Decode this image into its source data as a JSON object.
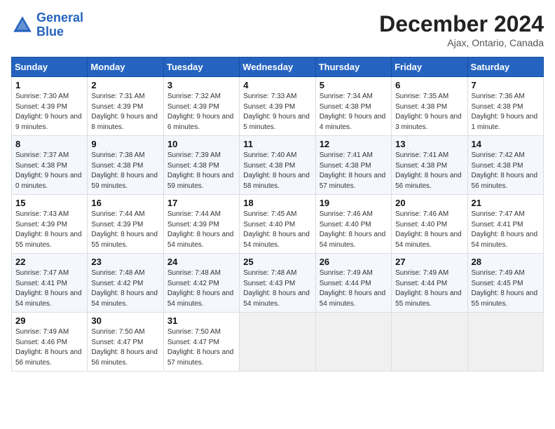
{
  "header": {
    "logo_line1": "General",
    "logo_line2": "Blue",
    "month_title": "December 2024",
    "location": "Ajax, Ontario, Canada"
  },
  "weekdays": [
    "Sunday",
    "Monday",
    "Tuesday",
    "Wednesday",
    "Thursday",
    "Friday",
    "Saturday"
  ],
  "weeks": [
    [
      {
        "day": "1",
        "sunrise": "7:30 AM",
        "sunset": "4:39 PM",
        "daylight": "9 hours and 9 minutes."
      },
      {
        "day": "2",
        "sunrise": "7:31 AM",
        "sunset": "4:39 PM",
        "daylight": "9 hours and 8 minutes."
      },
      {
        "day": "3",
        "sunrise": "7:32 AM",
        "sunset": "4:39 PM",
        "daylight": "9 hours and 6 minutes."
      },
      {
        "day": "4",
        "sunrise": "7:33 AM",
        "sunset": "4:39 PM",
        "daylight": "9 hours and 5 minutes."
      },
      {
        "day": "5",
        "sunrise": "7:34 AM",
        "sunset": "4:38 PM",
        "daylight": "9 hours and 4 minutes."
      },
      {
        "day": "6",
        "sunrise": "7:35 AM",
        "sunset": "4:38 PM",
        "daylight": "9 hours and 3 minutes."
      },
      {
        "day": "7",
        "sunrise": "7:36 AM",
        "sunset": "4:38 PM",
        "daylight": "9 hours and 1 minute."
      }
    ],
    [
      {
        "day": "8",
        "sunrise": "7:37 AM",
        "sunset": "4:38 PM",
        "daylight": "9 hours and 0 minutes."
      },
      {
        "day": "9",
        "sunrise": "7:38 AM",
        "sunset": "4:38 PM",
        "daylight": "8 hours and 59 minutes."
      },
      {
        "day": "10",
        "sunrise": "7:39 AM",
        "sunset": "4:38 PM",
        "daylight": "8 hours and 59 minutes."
      },
      {
        "day": "11",
        "sunrise": "7:40 AM",
        "sunset": "4:38 PM",
        "daylight": "8 hours and 58 minutes."
      },
      {
        "day": "12",
        "sunrise": "7:41 AM",
        "sunset": "4:38 PM",
        "daylight": "8 hours and 57 minutes."
      },
      {
        "day": "13",
        "sunrise": "7:41 AM",
        "sunset": "4:38 PM",
        "daylight": "8 hours and 56 minutes."
      },
      {
        "day": "14",
        "sunrise": "7:42 AM",
        "sunset": "4:38 PM",
        "daylight": "8 hours and 56 minutes."
      }
    ],
    [
      {
        "day": "15",
        "sunrise": "7:43 AM",
        "sunset": "4:39 PM",
        "daylight": "8 hours and 55 minutes."
      },
      {
        "day": "16",
        "sunrise": "7:44 AM",
        "sunset": "4:39 PM",
        "daylight": "8 hours and 55 minutes."
      },
      {
        "day": "17",
        "sunrise": "7:44 AM",
        "sunset": "4:39 PM",
        "daylight": "8 hours and 54 minutes."
      },
      {
        "day": "18",
        "sunrise": "7:45 AM",
        "sunset": "4:40 PM",
        "daylight": "8 hours and 54 minutes."
      },
      {
        "day": "19",
        "sunrise": "7:46 AM",
        "sunset": "4:40 PM",
        "daylight": "8 hours and 54 minutes."
      },
      {
        "day": "20",
        "sunrise": "7:46 AM",
        "sunset": "4:40 PM",
        "daylight": "8 hours and 54 minutes."
      },
      {
        "day": "21",
        "sunrise": "7:47 AM",
        "sunset": "4:41 PM",
        "daylight": "8 hours and 54 minutes."
      }
    ],
    [
      {
        "day": "22",
        "sunrise": "7:47 AM",
        "sunset": "4:41 PM",
        "daylight": "8 hours and 54 minutes."
      },
      {
        "day": "23",
        "sunrise": "7:48 AM",
        "sunset": "4:42 PM",
        "daylight": "8 hours and 54 minutes."
      },
      {
        "day": "24",
        "sunrise": "7:48 AM",
        "sunset": "4:42 PM",
        "daylight": "8 hours and 54 minutes."
      },
      {
        "day": "25",
        "sunrise": "7:48 AM",
        "sunset": "4:43 PM",
        "daylight": "8 hours and 54 minutes."
      },
      {
        "day": "26",
        "sunrise": "7:49 AM",
        "sunset": "4:44 PM",
        "daylight": "8 hours and 54 minutes."
      },
      {
        "day": "27",
        "sunrise": "7:49 AM",
        "sunset": "4:44 PM",
        "daylight": "8 hours and 55 minutes."
      },
      {
        "day": "28",
        "sunrise": "7:49 AM",
        "sunset": "4:45 PM",
        "daylight": "8 hours and 55 minutes."
      }
    ],
    [
      {
        "day": "29",
        "sunrise": "7:49 AM",
        "sunset": "4:46 PM",
        "daylight": "8 hours and 56 minutes."
      },
      {
        "day": "30",
        "sunrise": "7:50 AM",
        "sunset": "4:47 PM",
        "daylight": "8 hours and 56 minutes."
      },
      {
        "day": "31",
        "sunrise": "7:50 AM",
        "sunset": "4:47 PM",
        "daylight": "8 hours and 57 minutes."
      },
      null,
      null,
      null,
      null
    ]
  ]
}
